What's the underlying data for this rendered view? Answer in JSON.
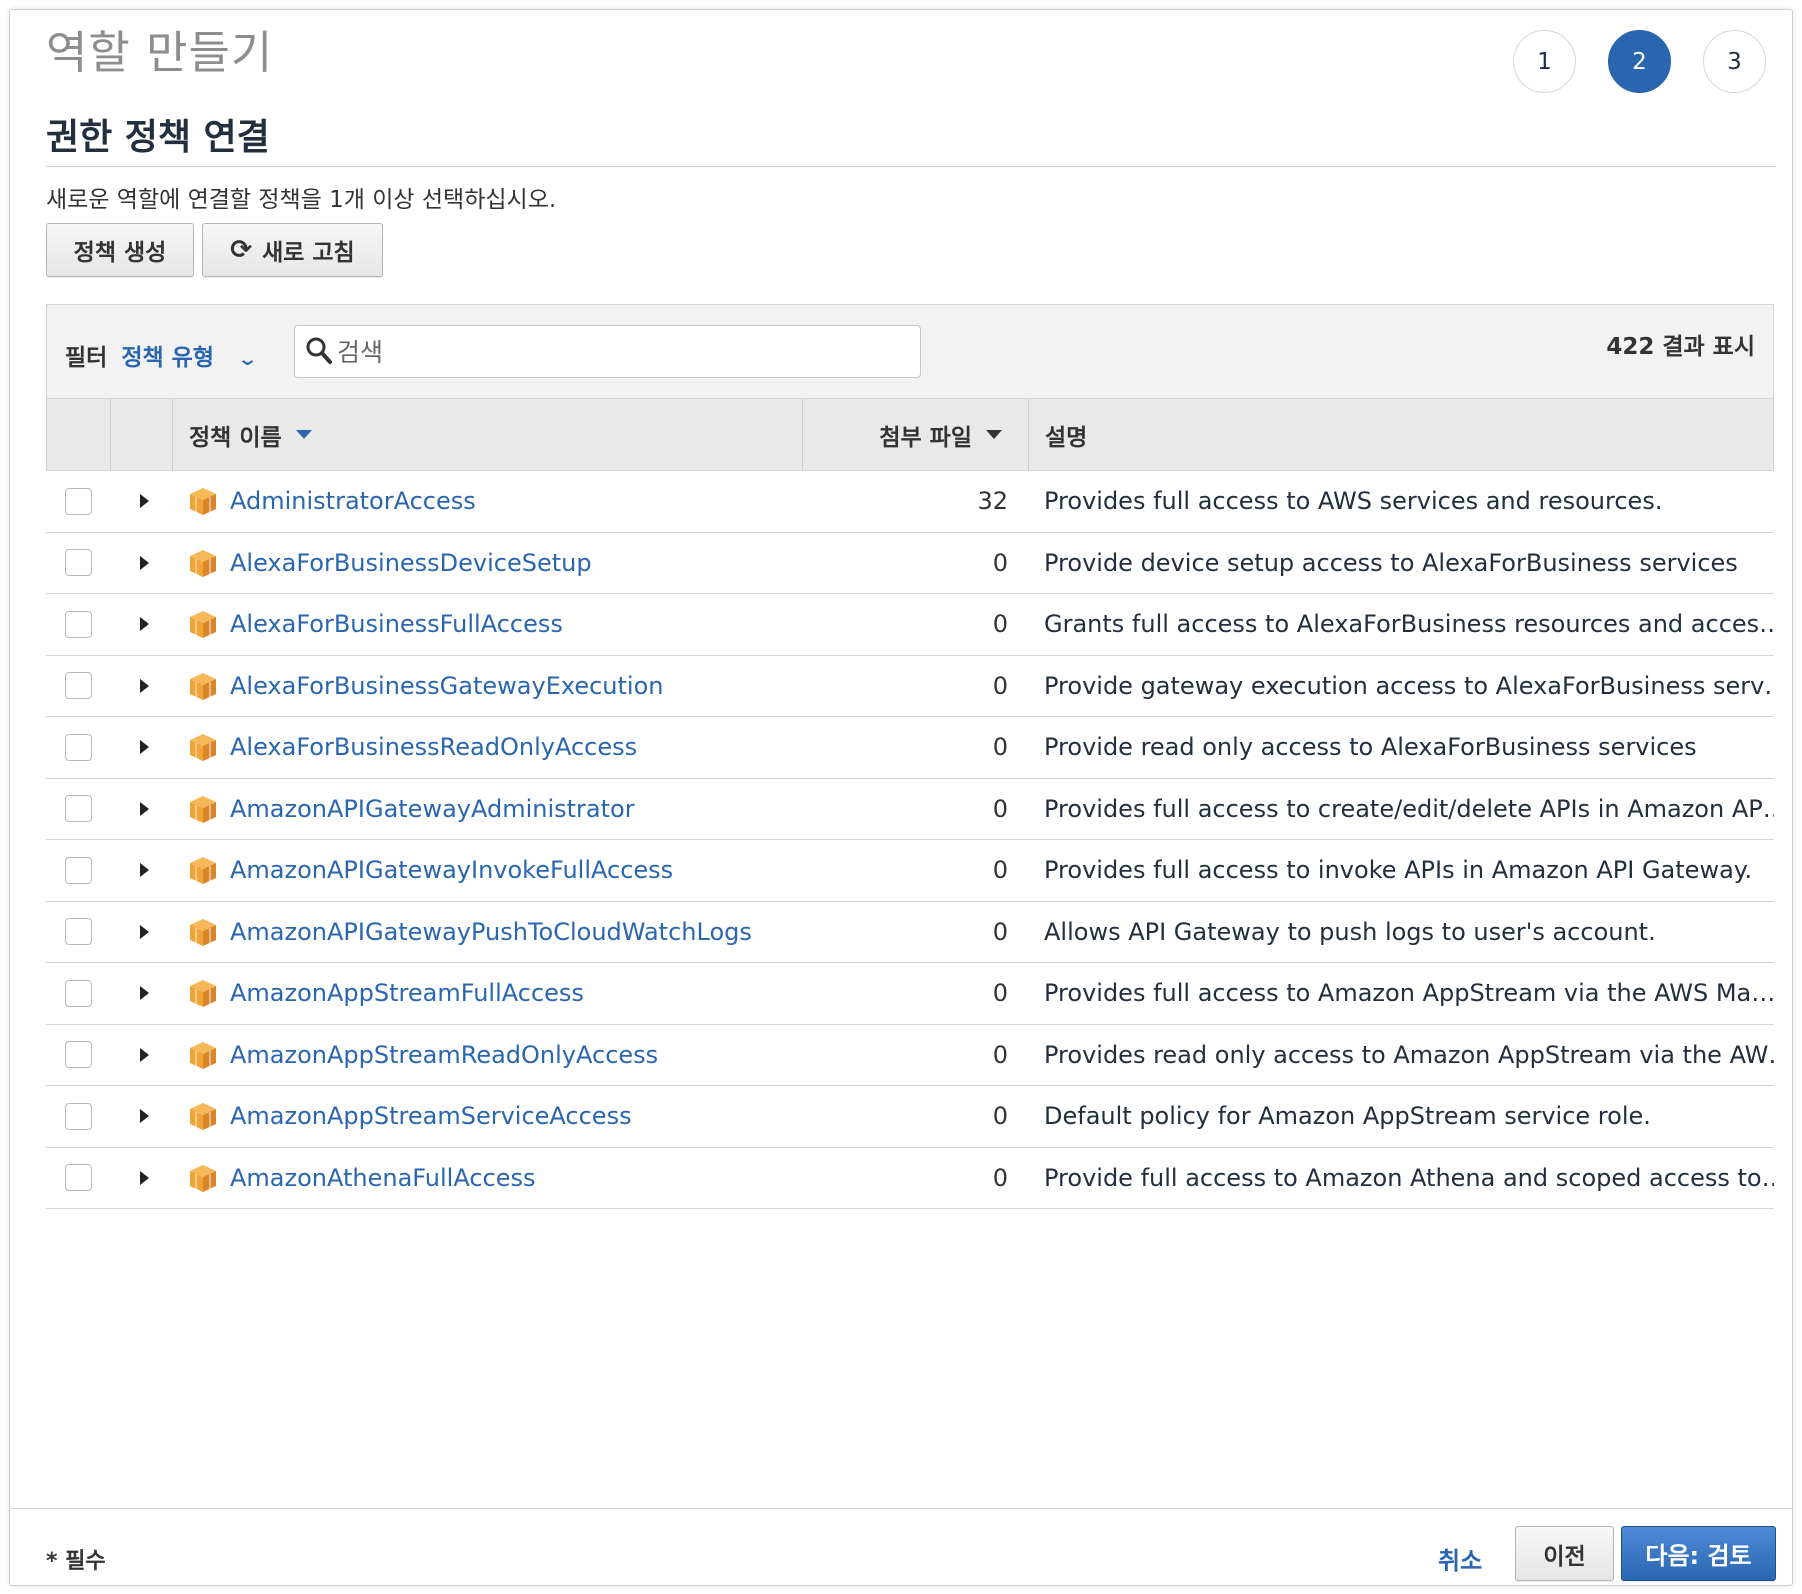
{
  "header": {
    "page_title": "역할 만들기",
    "steps": [
      "1",
      "2",
      "3"
    ],
    "active_step": "2"
  },
  "section": {
    "title": "권한 정책 연결",
    "subtitle": "새로운 역할에 연결할 정책을 1개 이상 선택하십시오."
  },
  "actions": {
    "create_policy": "정책 생성",
    "refresh": "새로 고침"
  },
  "filter": {
    "label": "필터",
    "value": "정책 유형",
    "search_placeholder": "검색",
    "result_count": "422 결과 표시"
  },
  "table": {
    "columns": {
      "name": "정책 이름",
      "attachments": "첨부 파일",
      "description": "설명"
    },
    "rows": [
      {
        "name": "AdministratorAccess",
        "attachments": "32",
        "description": "Provides full access to AWS services and resources."
      },
      {
        "name": "AlexaForBusinessDeviceSetup",
        "attachments": "0",
        "description": "Provide device setup access to AlexaForBusiness services"
      },
      {
        "name": "AlexaForBusinessFullAccess",
        "attachments": "0",
        "description": "Grants full access to AlexaForBusiness resources and acces…"
      },
      {
        "name": "AlexaForBusinessGatewayExecution",
        "attachments": "0",
        "description": "Provide gateway execution access to AlexaForBusiness serv…"
      },
      {
        "name": "AlexaForBusinessReadOnlyAccess",
        "attachments": "0",
        "description": "Provide read only access to AlexaForBusiness services"
      },
      {
        "name": "AmazonAPIGatewayAdministrator",
        "attachments": "0",
        "description": "Provides full access to create/edit/delete APIs in Amazon AP…"
      },
      {
        "name": "AmazonAPIGatewayInvokeFullAccess",
        "attachments": "0",
        "description": "Provides full access to invoke APIs in Amazon API Gateway."
      },
      {
        "name": "AmazonAPIGatewayPushToCloudWatchLogs",
        "attachments": "0",
        "description": "Allows API Gateway to push logs to user's account."
      },
      {
        "name": "AmazonAppStreamFullAccess",
        "attachments": "0",
        "description": "Provides full access to Amazon AppStream via the AWS Ma…"
      },
      {
        "name": "AmazonAppStreamReadOnlyAccess",
        "attachments": "0",
        "description": "Provides read only access to Amazon AppStream via the AW…"
      },
      {
        "name": "AmazonAppStreamServiceAccess",
        "attachments": "0",
        "description": "Default policy for Amazon AppStream service role."
      },
      {
        "name": "AmazonAthenaFullAccess",
        "attachments": "0",
        "description": "Provide full access to Amazon Athena and scoped access to…"
      }
    ]
  },
  "footer": {
    "required_note": "* 필수",
    "cancel": "취소",
    "previous": "이전",
    "next": "다음: 검토"
  },
  "colors": {
    "accent": "#2a66b0",
    "policy_icon": "#f0a336"
  },
  "icons": {
    "refresh": "refresh-icon",
    "search": "search-icon",
    "policy": "box-icon",
    "filter_dropdown": "chevron-down-icon"
  }
}
